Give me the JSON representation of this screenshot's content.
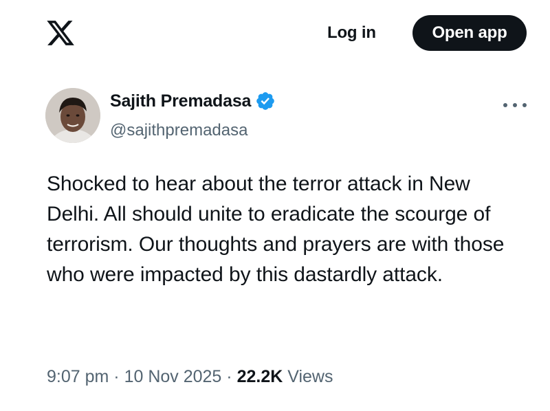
{
  "header": {
    "logo_icon": "x-logo-icon",
    "login_label": "Log in",
    "open_app_label": "Open app"
  },
  "tweet": {
    "author": {
      "display_name": "Sajith Premadasa",
      "handle": "@sajithpremadasa",
      "verified": true,
      "verified_icon": "verified-badge-icon",
      "verified_color": "#1d9bf0"
    },
    "more_icon": "more-horizontal-icon",
    "text": "Shocked to hear about the terror attack in New Delhi. All should unite to eradicate the scourge of terrorism. Our thoughts and prayers are with those who were impacted by this dastardly attack.",
    "time": "9:07 pm",
    "separator": " · ",
    "date": "10 Nov 2025",
    "views_count": "22.2K",
    "views_label": " Views"
  }
}
